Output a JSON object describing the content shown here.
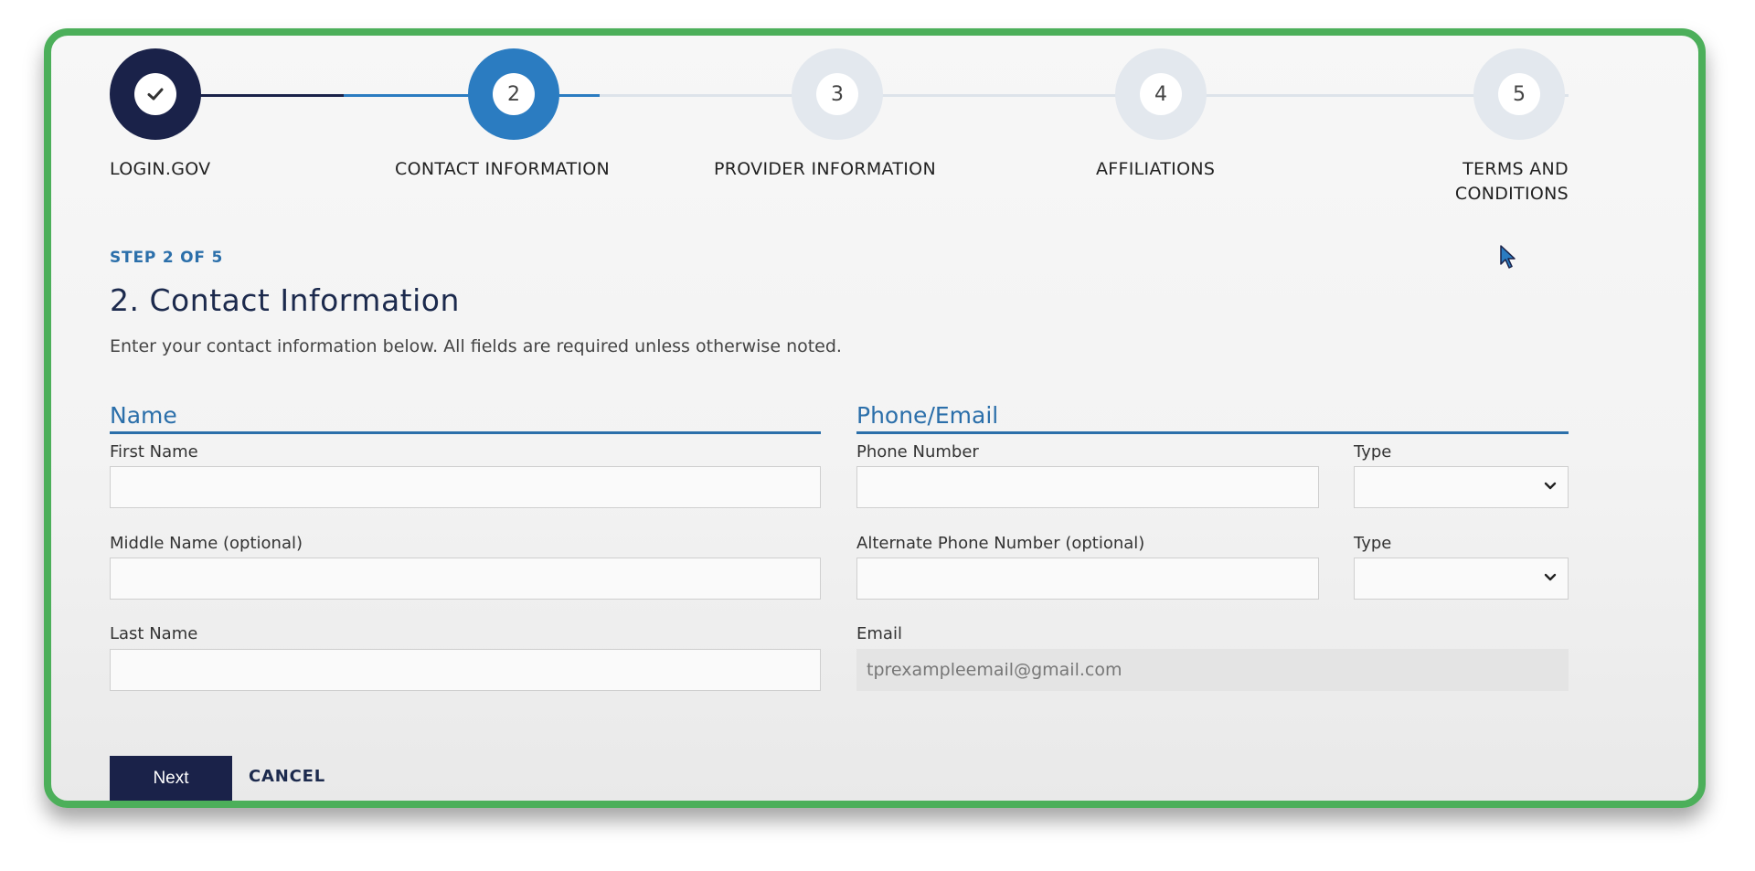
{
  "stepper": {
    "steps": [
      {
        "number": "",
        "label": "LOGIN.GOV",
        "state": "completed"
      },
      {
        "number": "2",
        "label": "CONTACT INFORMATION",
        "state": "current"
      },
      {
        "number": "3",
        "label": "PROVIDER INFORMATION",
        "state": "upcoming"
      },
      {
        "number": "4",
        "label": "AFFILIATIONS",
        "state": "upcoming"
      },
      {
        "number": "5",
        "label_line1": "TERMS AND",
        "label_line2": "CONDITIONS",
        "state": "upcoming"
      }
    ],
    "colors": {
      "completed": "#1a2249",
      "current": "#2b7cc1",
      "upcoming": "#e3e8ee"
    }
  },
  "header": {
    "step_of": "STEP 2 OF 5",
    "title": "2. Contact Information",
    "intro": "Enter your contact information below. All fields are required unless otherwise noted."
  },
  "name_section": {
    "title": "Name",
    "first_name_label": "First Name",
    "first_name_value": "",
    "middle_name_label": "Middle Name (optional)",
    "middle_name_value": "",
    "last_name_label": "Last Name",
    "last_name_value": ""
  },
  "phone_section": {
    "title": "Phone/Email",
    "phone_label": "Phone Number",
    "phone_value": "",
    "phone_type_label": "Type",
    "alt_phone_label": "Alternate Phone Number (optional)",
    "alt_phone_value": "",
    "alt_phone_type_label": "Type",
    "email_label": "Email",
    "email_value": "tprexampleemail@gmail.com"
  },
  "actions": {
    "next_label": "Next",
    "cancel_label": "CANCEL"
  },
  "colors": {
    "frame_border": "#4caf5a",
    "accent_blue": "#2b6faa",
    "navy": "#1a2249"
  }
}
